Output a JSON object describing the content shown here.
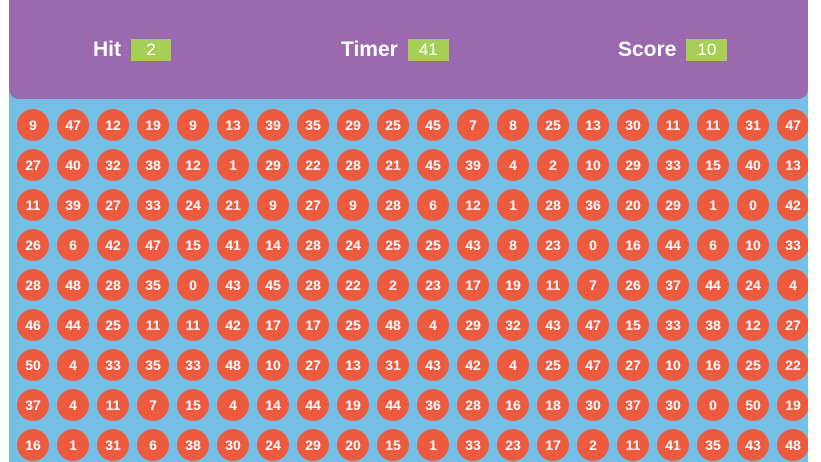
{
  "hud": {
    "hit_label": "Hit",
    "hit_value": "2",
    "timer_label": "Timer",
    "timer_value": "41",
    "score_label": "Score",
    "score_value": "10"
  },
  "colors": {
    "panel": "#9b69ad",
    "board": "#75bfe7",
    "ball": "#ee5a3e",
    "badge": "#a7cf56"
  },
  "balls": [
    [
      "9",
      "47",
      "12",
      "19",
      "9",
      "13",
      "39",
      "35",
      "29",
      "25",
      "45",
      "7",
      "8",
      "25",
      "13",
      "30",
      "11",
      "11",
      "31",
      "47"
    ],
    [
      "27",
      "40",
      "32",
      "38",
      "12",
      "1",
      "29",
      "22",
      "28",
      "21",
      "45",
      "39",
      "4",
      "2",
      "10",
      "29",
      "33",
      "15",
      "40",
      "13"
    ],
    [
      "11",
      "39",
      "27",
      "33",
      "24",
      "21",
      "9",
      "27",
      "9",
      "28",
      "6",
      "12",
      "1",
      "28",
      "36",
      "20",
      "29",
      "1",
      "0",
      "42"
    ],
    [
      "26",
      "6",
      "42",
      "47",
      "15",
      "41",
      "14",
      "28",
      "24",
      "25",
      "25",
      "43",
      "8",
      "23",
      "0",
      "16",
      "44",
      "6",
      "10",
      "33"
    ],
    [
      "28",
      "48",
      "28",
      "35",
      "0",
      "43",
      "45",
      "28",
      "22",
      "2",
      "23",
      "17",
      "19",
      "11",
      "7",
      "26",
      "37",
      "44",
      "24",
      "4"
    ],
    [
      "46",
      "44",
      "25",
      "11",
      "11",
      "42",
      "17",
      "17",
      "25",
      "48",
      "4",
      "29",
      "32",
      "43",
      "47",
      "15",
      "33",
      "38",
      "12",
      "27"
    ],
    [
      "50",
      "4",
      "33",
      "35",
      "33",
      "48",
      "10",
      "27",
      "13",
      "31",
      "43",
      "42",
      "4",
      "25",
      "47",
      "27",
      "10",
      "16",
      "25",
      "22"
    ],
    [
      "37",
      "4",
      "11",
      "7",
      "15",
      "4",
      "14",
      "44",
      "19",
      "44",
      "36",
      "28",
      "16",
      "18",
      "30",
      "37",
      "30",
      "0",
      "50",
      "19"
    ],
    [
      "16",
      "1",
      "31",
      "6",
      "38",
      "30",
      "24",
      "29",
      "20",
      "15",
      "1",
      "33",
      "23",
      "17",
      "2",
      "11",
      "41",
      "35",
      "43",
      "48"
    ]
  ]
}
